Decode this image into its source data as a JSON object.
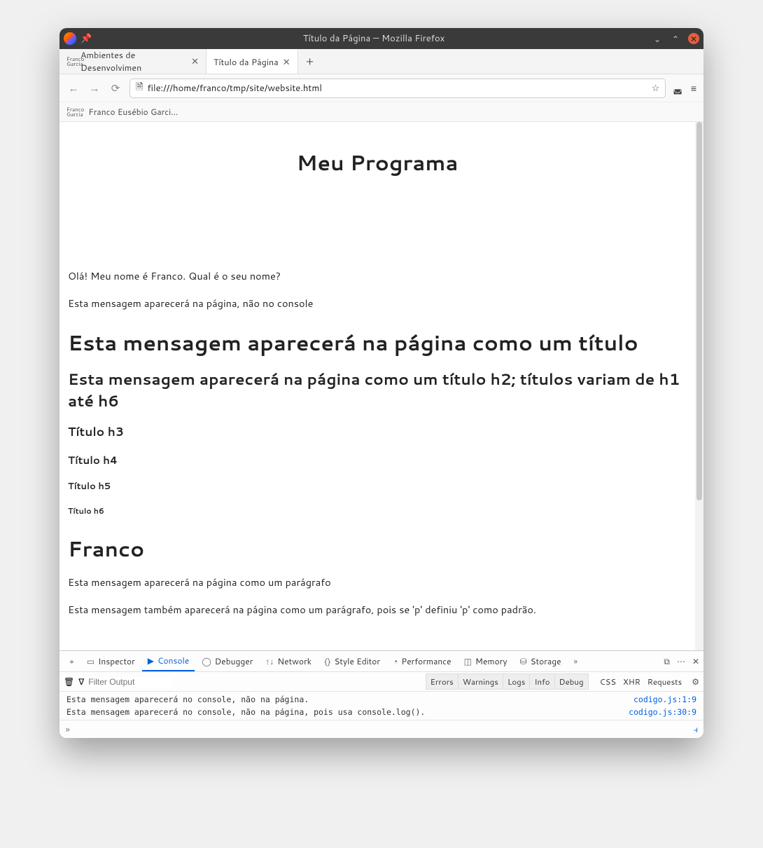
{
  "window": {
    "title": "Título da Página — Mozilla Firefox"
  },
  "tabs": [
    {
      "label": "Ambientes de Desenvolvimen"
    },
    {
      "label": "Título da Página"
    }
  ],
  "url": "file:///home/franco/tmp/site/website.html",
  "bookmark": "Franco Eusébio Garci...",
  "page": {
    "title_center": "Meu Programa",
    "p1": "Olá! Meu nome é Franco. Qual é o seu nome?",
    "p2": "Esta mensagem aparecerá na página, não no console",
    "h1": "Esta mensagem aparecerá na página como um título",
    "h2": "Esta mensagem aparecerá na página como um título h2; títulos variam de h1 até h6",
    "h3": "Título h3",
    "h4": "Título h4",
    "h5": "Título h5",
    "h6": "Título h6",
    "h1b": "Franco",
    "p3": "Esta mensagem aparecerá na página como um parágrafo",
    "p4": "Esta mensagem também aparecerá na página como um parágrafo, pois se 'p' definiu 'p' como padrão."
  },
  "devtools": {
    "tabs": {
      "inspector": "Inspector",
      "console": "Console",
      "debugger": "Debugger",
      "network": "Network",
      "style": "Style Editor",
      "perf": "Performance",
      "memory": "Memory",
      "storage": "Storage"
    },
    "filter_placeholder": "Filter Output",
    "chips": {
      "errors": "Errors",
      "warnings": "Warnings",
      "logs": "Logs",
      "info": "Info",
      "debug": "Debug"
    },
    "plain": {
      "css": "CSS",
      "xhr": "XHR",
      "requests": "Requests"
    },
    "logs": [
      {
        "msg": "Esta mensagem aparecerá no console, não na página.",
        "src": "codigo.js:1:9"
      },
      {
        "msg": "Esta mensagem aparecerá no console, não na página, pois usa console.log().",
        "src": "codigo.js:30:9"
      }
    ],
    "prompt": "»"
  }
}
